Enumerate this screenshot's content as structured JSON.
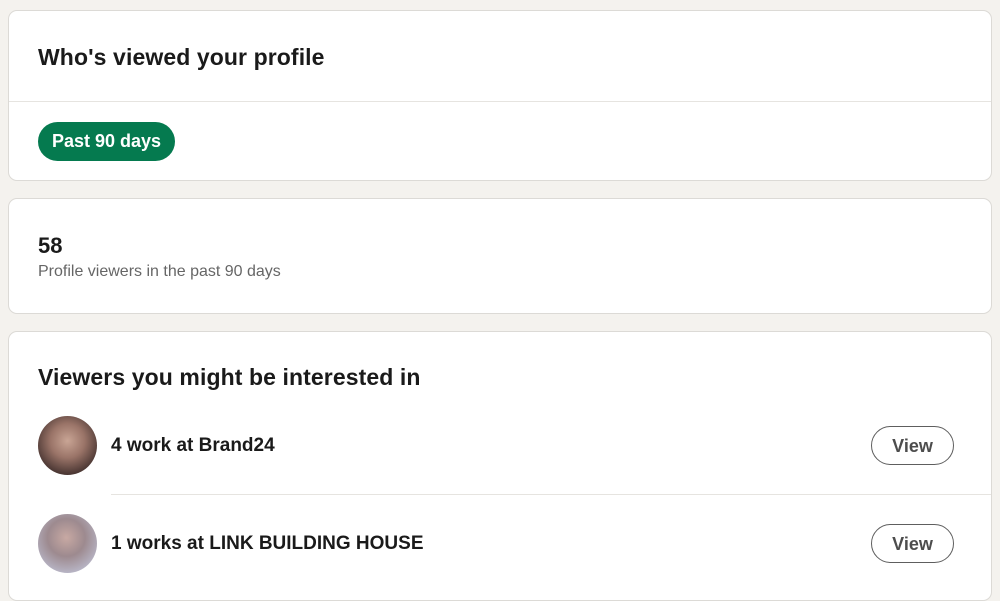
{
  "header_card": {
    "title": "Who's viewed your profile",
    "filter_pill": "Past 90 days"
  },
  "stats_card": {
    "count": "58",
    "label": "Profile viewers in the past 90 days"
  },
  "viewers_card": {
    "title": "Viewers you might be interested in",
    "items": [
      {
        "text": "4 work at Brand24",
        "button": "View"
      },
      {
        "text": "1 works at LINK BUILDING HOUSE",
        "button": "View"
      }
    ]
  },
  "colors": {
    "page_background": "#f4f2ee",
    "pill_green": "#057a4f",
    "card_background": "#ffffff"
  }
}
